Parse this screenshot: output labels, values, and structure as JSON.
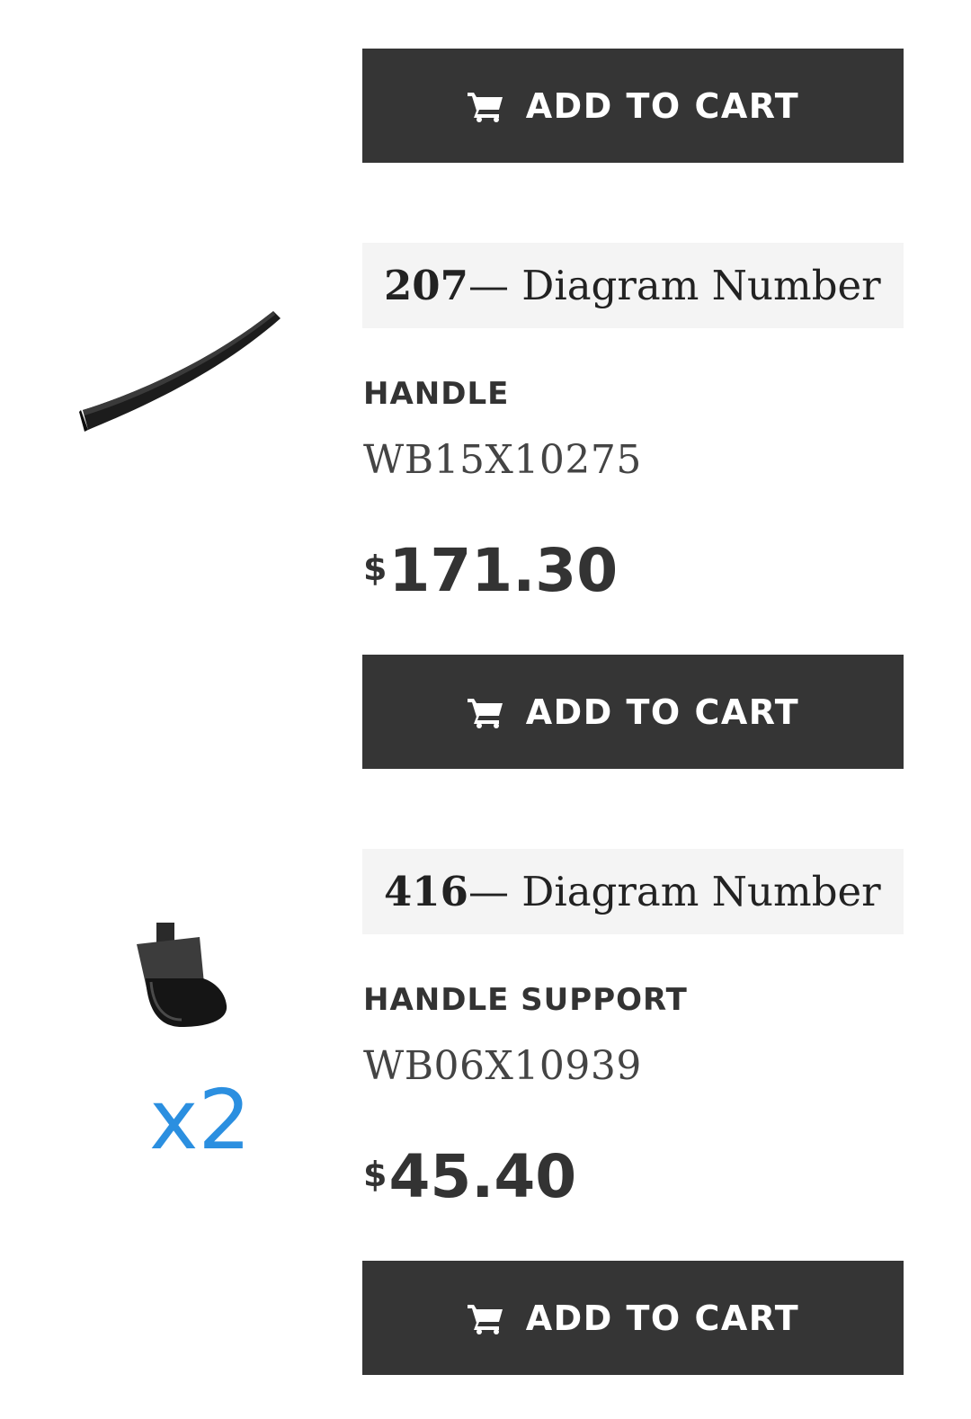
{
  "items": [
    {
      "add_to_cart_label": "ADD TO CART"
    },
    {
      "diagram_number": "207",
      "diagram_suffix": " — Diagram Number",
      "name": "HANDLE",
      "part_number": "WB15X10275",
      "currency": "$",
      "price": "171.30",
      "image_icon": "handle-part-image",
      "add_to_cart_label": "ADD TO CART"
    },
    {
      "diagram_number": "416",
      "diagram_suffix": " — Diagram Number",
      "name": "HANDLE SUPPORT",
      "part_number": "WB06X10939",
      "currency": "$",
      "price": "45.40",
      "quantity": "x2",
      "image_icon": "handle-support-part-image",
      "add_to_cart_label": "ADD TO CART"
    }
  ],
  "colors": {
    "button_bg": "#353535",
    "button_text": "#ffffff",
    "diagram_bg": "#f4f4f4",
    "quantity_accent": "#2b8fe0"
  },
  "icons": {
    "cart": "shopping-cart-icon"
  }
}
